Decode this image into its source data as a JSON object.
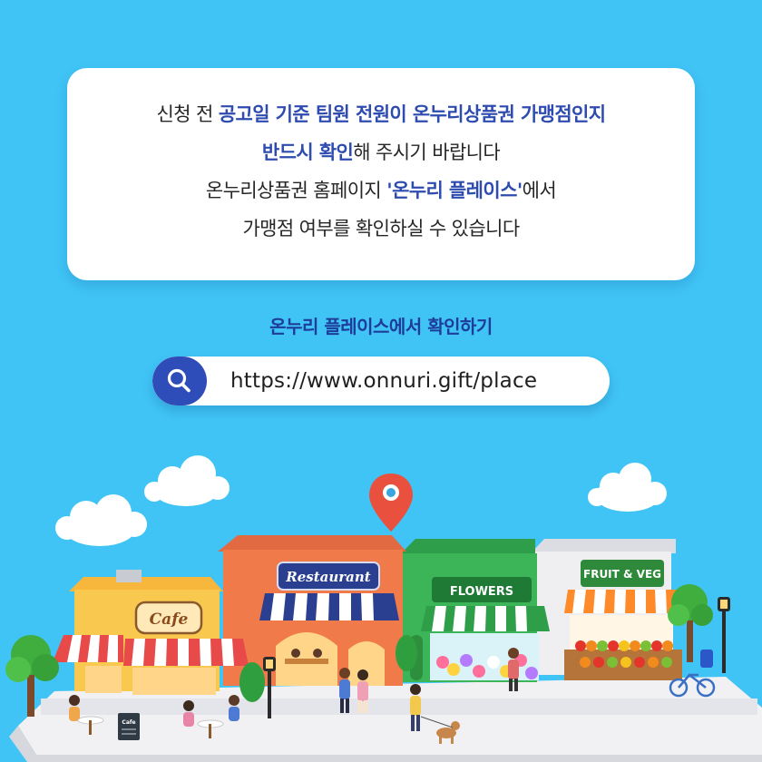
{
  "notice": {
    "l1_a": "신청 전 ",
    "l1_b": "공고일 기준 팀원 전원이 온누리상품권 가맹점인지",
    "l2_a": "반드시 확인",
    "l2_b": "해 주시기 바랍니다",
    "l3_a": "온누리상품권 홈페이지 ",
    "l3_b": "'온누리 플레이스'",
    "l3_c": "에서",
    "l4": "가맹점 여부를 확인하실 수 있습니다"
  },
  "cta": {
    "title": "온누리 플레이스에서 확인하기"
  },
  "search": {
    "url": "https://www.onnuri.gift/place",
    "icon": "search-icon"
  },
  "shops": {
    "cafe": "Cafe",
    "restaurant": "Restaurant",
    "flowers": "FLOWERS",
    "fruit": "FRUIT & VEG",
    "menu_board": "Cafe"
  },
  "colors": {
    "background": "#40c4f6",
    "accent": "#2e4bb0",
    "pin": "#e9513e"
  }
}
